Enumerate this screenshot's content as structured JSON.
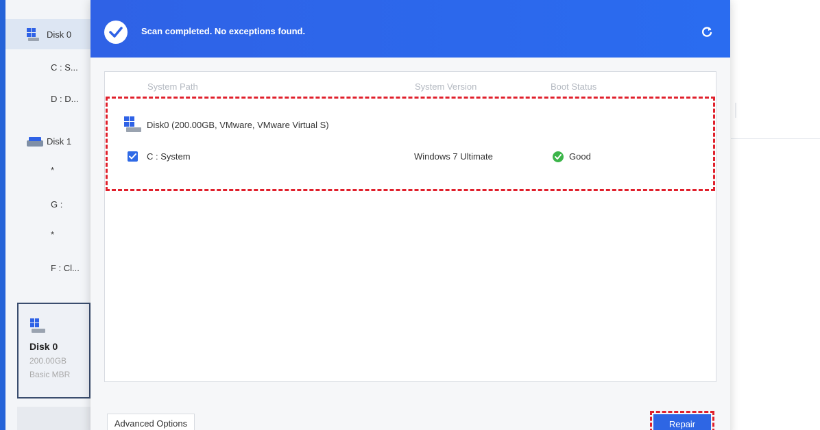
{
  "sidebar": {
    "disks": [
      {
        "label": "Disk 0",
        "partitions": [
          "C : S...",
          "D : D..."
        ]
      },
      {
        "label": "Disk 1",
        "partitions": [
          "*",
          "G :",
          "*",
          "F : Cl..."
        ]
      }
    ],
    "disk_card": {
      "name": "Disk 0",
      "size": "200.00GB",
      "type": "Basic MBR"
    }
  },
  "dialog": {
    "title": "Scan completed. No exceptions found.",
    "table": {
      "headers": {
        "path": "System Path",
        "version": "System Version",
        "boot": "Boot Status"
      },
      "disk_label": "Disk0 (200.00GB, VMware, VMware Virtual S)",
      "rows": [
        {
          "path": "C : System",
          "version": "Windows 7 Ultimate",
          "status": "Good",
          "checked": true
        }
      ]
    },
    "advanced_label": "Advanced Options",
    "repair_label": "Repair"
  },
  "colors": {
    "accent": "#2f62e6",
    "highlight": "#e0202c",
    "good": "#3cb54a"
  },
  "icons": {
    "check": "check-circle-icon",
    "refresh": "refresh-icon",
    "disk": "disk-icon",
    "status": "status-good-icon"
  }
}
